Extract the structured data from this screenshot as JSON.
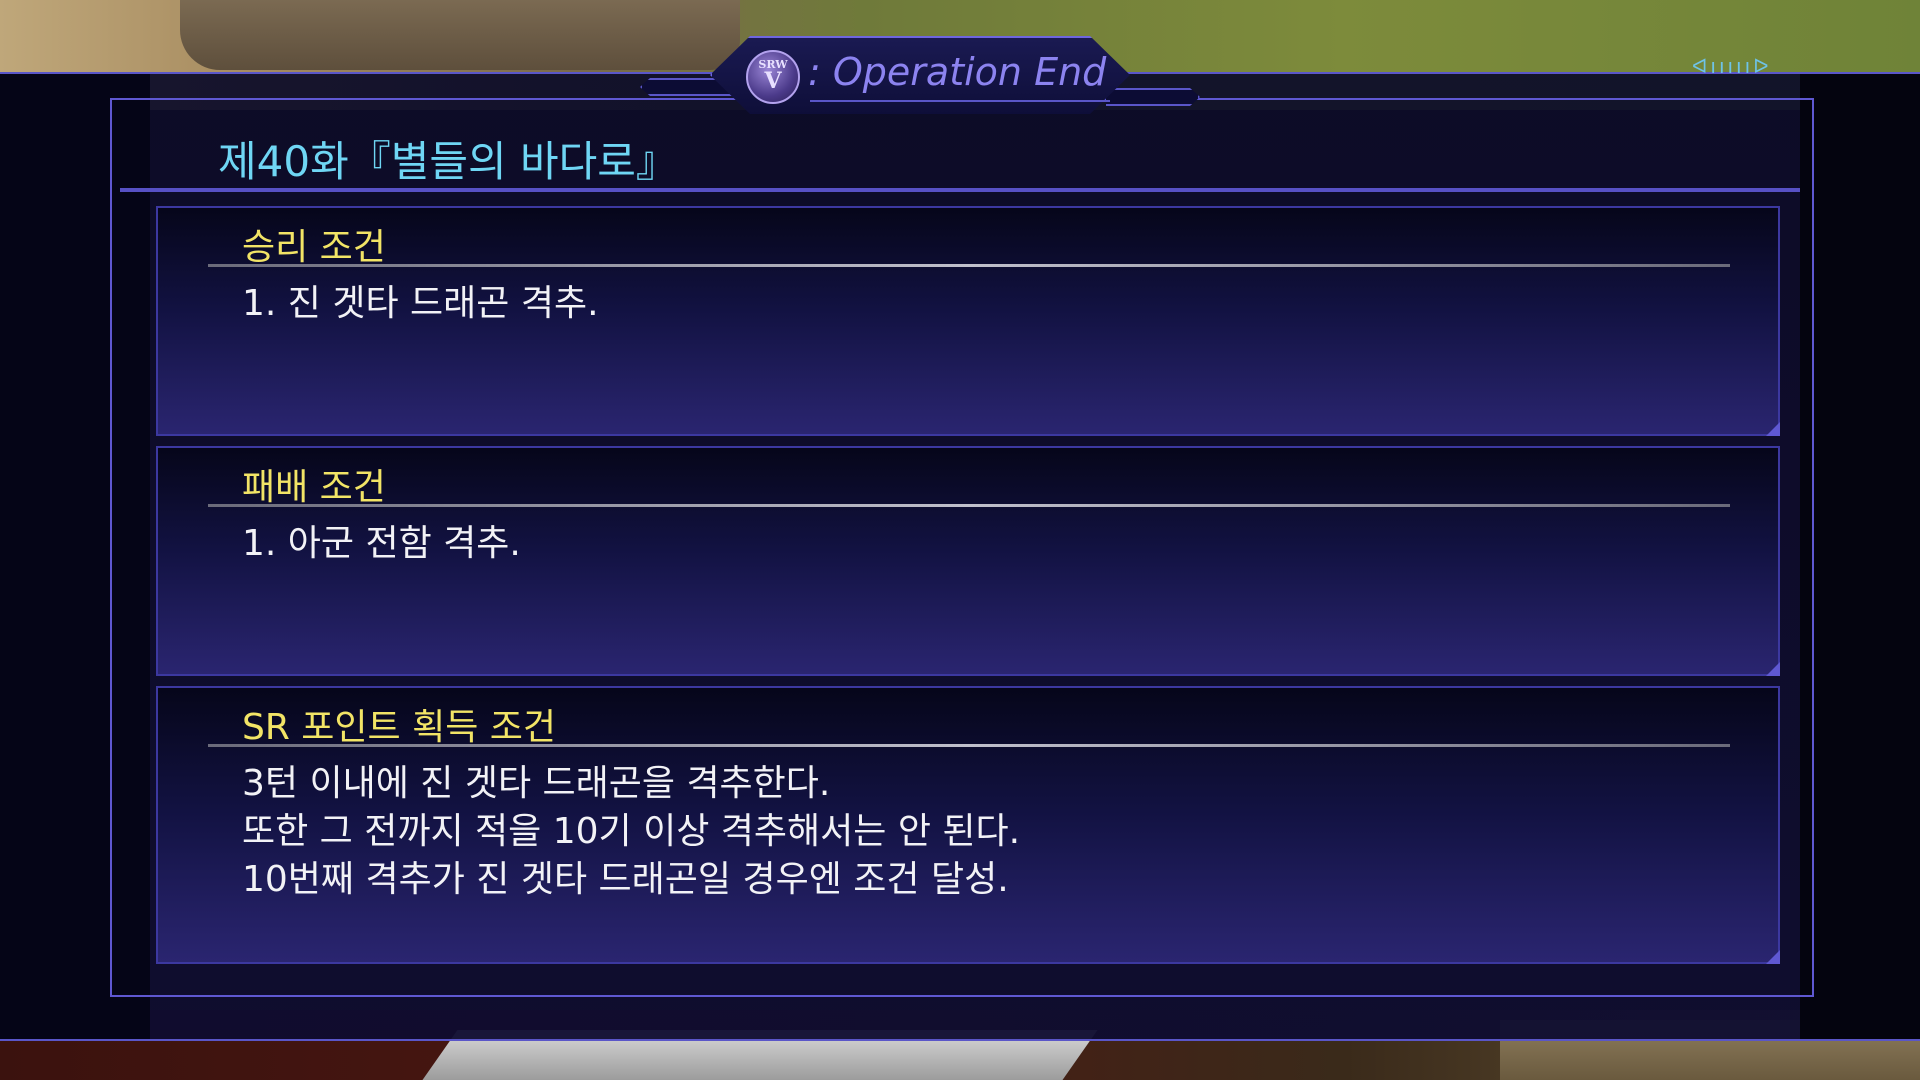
{
  "header": {
    "logo_text_top": "SRW",
    "logo_text_main": "V",
    "title": ": Operation End"
  },
  "chapter": {
    "title": "제40화『별들의 바다로』"
  },
  "sections": [
    {
      "heading": "승리 조건",
      "lines": [
        "1. 진 겟타 드래곤 격추."
      ]
    },
    {
      "heading": "패배 조건",
      "lines": [
        "1. 아군 전함 격추."
      ]
    },
    {
      "heading": "SR 포인트 획득 조건",
      "lines": [
        "3턴 이내에 진 겟타 드래곤을 격추한다.",
        "또한 그 전까지 적을 10기 이상 격추해서는 안 된다.",
        "10번째 격추가 진 겟타 드래곤일 경우엔 조건 달성."
      ]
    }
  ],
  "colors": {
    "heading": "#f2e466",
    "chapter_title": "#6fd6f4",
    "header_title": "#8c83f0",
    "border": "#5f58d2"
  },
  "icons": {
    "logo": "srw-v-logo-icon",
    "indicator": "turn-indicator-icon"
  }
}
